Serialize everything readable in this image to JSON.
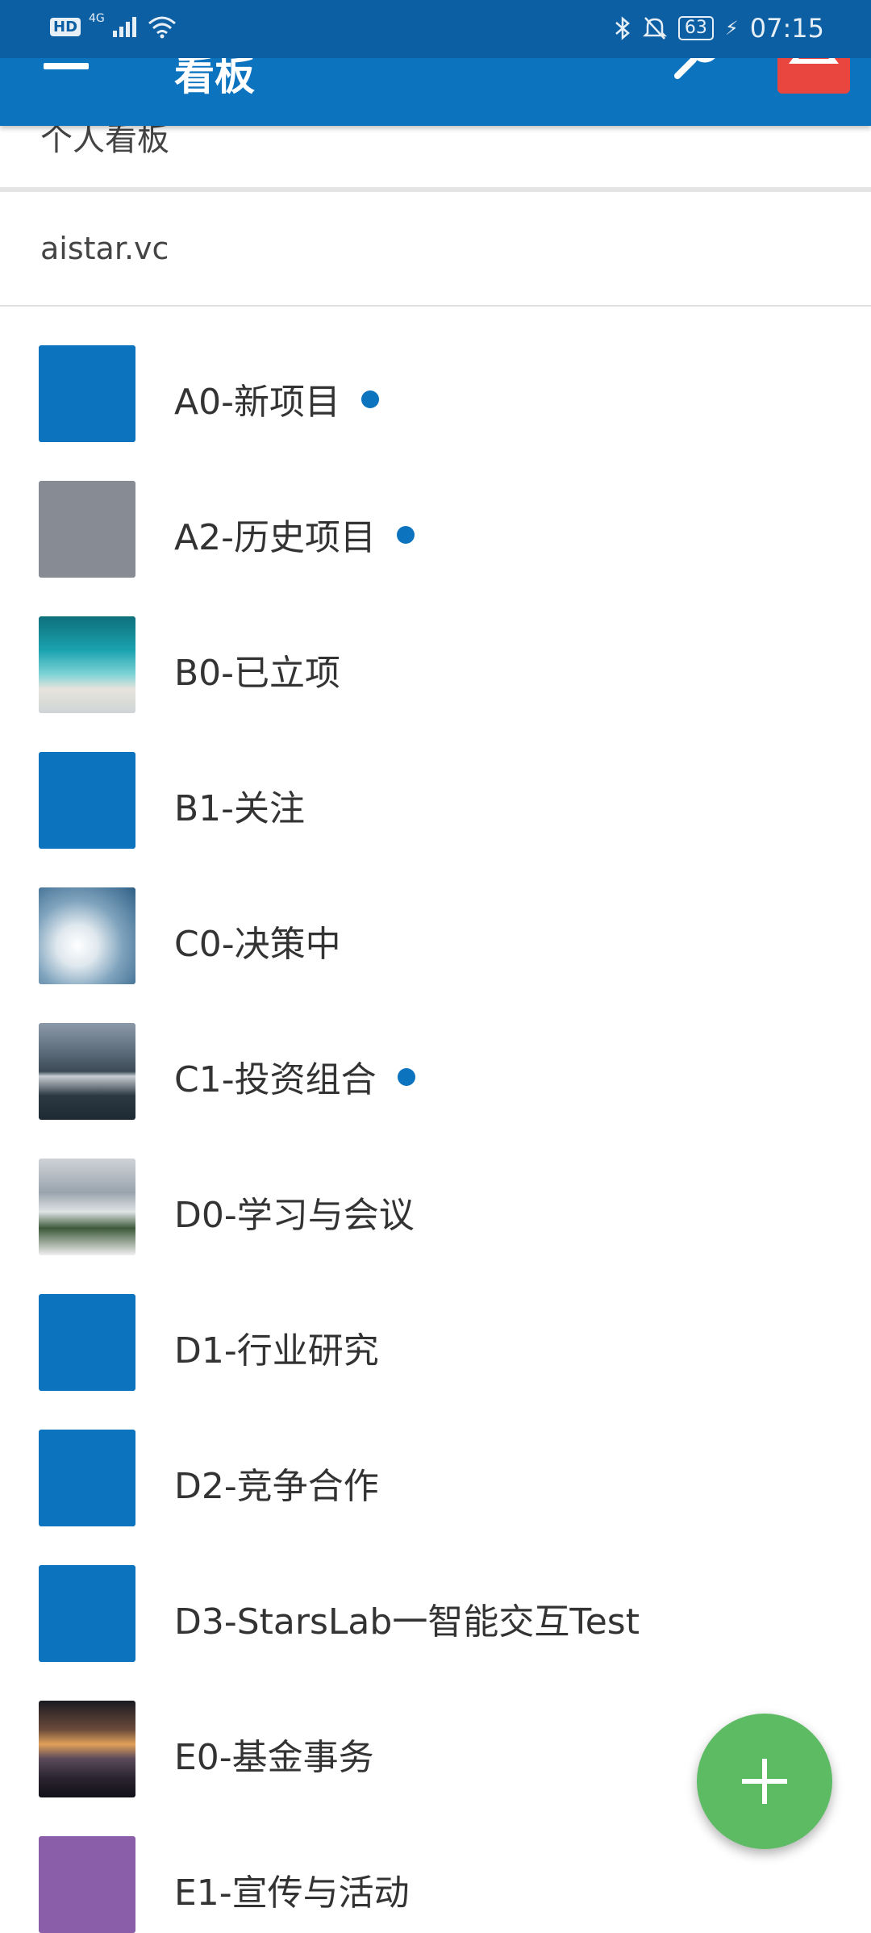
{
  "status_bar": {
    "hd": "HD",
    "network": "4G",
    "battery": "63",
    "time": "07:15"
  },
  "toolbar": {
    "title": "看板"
  },
  "sections": {
    "personal": "个人看板",
    "team": "aistar.vc"
  },
  "boards": [
    {
      "label": "A0-新项目",
      "thumb": "solid-blue",
      "color": "#0c73bf",
      "unread": true
    },
    {
      "label": "A2-历史项目",
      "thumb": "solid-gray",
      "color": "#878c94",
      "unread": true
    },
    {
      "label": "B0-已立项",
      "thumb": "image-ocean",
      "unread": false
    },
    {
      "label": "B1-关注",
      "thumb": "solid-blue",
      "color": "#0c73bf",
      "unread": false
    },
    {
      "label": "C0-决策中",
      "thumb": "image-clouds",
      "unread": false
    },
    {
      "label": "C1-投资组合",
      "thumb": "image-mountain-lake",
      "unread": true
    },
    {
      "label": "D0-学习与会议",
      "thumb": "image-snowy-forest",
      "unread": false
    },
    {
      "label": "D1-行业研究",
      "thumb": "solid-blue",
      "color": "#0c73bf",
      "unread": false
    },
    {
      "label": "D2-竞争合作",
      "thumb": "solid-blue",
      "color": "#0c73bf",
      "unread": false
    },
    {
      "label": "D3-StarsLab一智能交互Test",
      "thumb": "solid-blue",
      "color": "#0c73bf",
      "unread": false
    },
    {
      "label": "E0-基金事务",
      "thumb": "image-sunset-mountain",
      "unread": false
    },
    {
      "label": "E1-宣传与活动",
      "thumb": "solid-purple",
      "color": "#8a5ea8",
      "unread": false
    }
  ],
  "colors": {
    "status_bar": "#0c5fa3",
    "toolbar": "#0c73bf",
    "notification_bell": "#e9463f",
    "fab": "#5dbb63",
    "unread_dot": "#0c73bf"
  },
  "icons": {
    "menu": "hamburger-menu-icon",
    "search": "search-icon",
    "bell": "bell-icon",
    "fab": "plus-icon"
  }
}
